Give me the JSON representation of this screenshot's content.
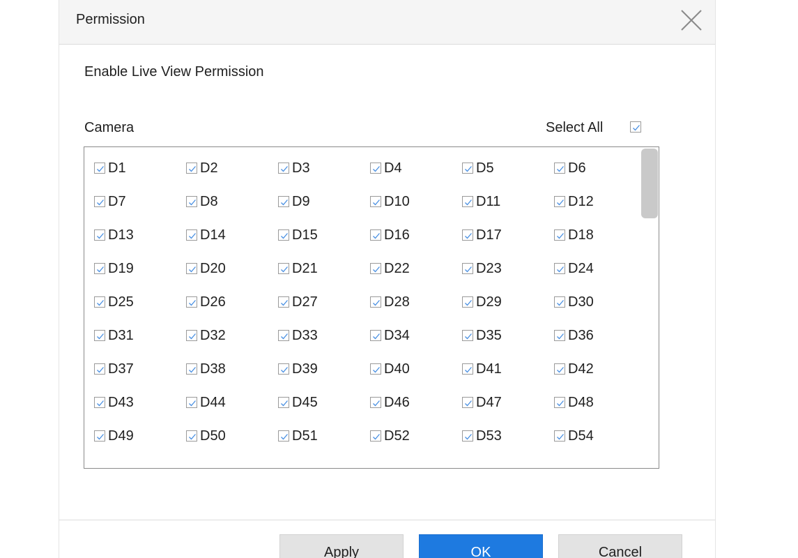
{
  "dialog": {
    "title": "Permission",
    "section_label": "Enable Live View Permission",
    "camera_label": "Camera",
    "select_all_label": "Select All",
    "select_all_checked": true
  },
  "cameras": [
    {
      "label": "D1",
      "checked": true
    },
    {
      "label": "D2",
      "checked": true
    },
    {
      "label": "D3",
      "checked": true
    },
    {
      "label": "D4",
      "checked": true
    },
    {
      "label": "D5",
      "checked": true
    },
    {
      "label": "D6",
      "checked": true
    },
    {
      "label": "D7",
      "checked": true
    },
    {
      "label": "D8",
      "checked": true
    },
    {
      "label": "D9",
      "checked": true
    },
    {
      "label": "D10",
      "checked": true
    },
    {
      "label": "D11",
      "checked": true
    },
    {
      "label": "D12",
      "checked": true
    },
    {
      "label": "D13",
      "checked": true
    },
    {
      "label": "D14",
      "checked": true
    },
    {
      "label": "D15",
      "checked": true
    },
    {
      "label": "D16",
      "checked": true
    },
    {
      "label": "D17",
      "checked": true
    },
    {
      "label": "D18",
      "checked": true
    },
    {
      "label": "D19",
      "checked": true
    },
    {
      "label": "D20",
      "checked": true
    },
    {
      "label": "D21",
      "checked": true
    },
    {
      "label": "D22",
      "checked": true
    },
    {
      "label": "D23",
      "checked": true
    },
    {
      "label": "D24",
      "checked": true
    },
    {
      "label": "D25",
      "checked": true
    },
    {
      "label": "D26",
      "checked": true
    },
    {
      "label": "D27",
      "checked": true
    },
    {
      "label": "D28",
      "checked": true
    },
    {
      "label": "D29",
      "checked": true
    },
    {
      "label": "D30",
      "checked": true
    },
    {
      "label": "D31",
      "checked": true
    },
    {
      "label": "D32",
      "checked": true
    },
    {
      "label": "D33",
      "checked": true
    },
    {
      "label": "D34",
      "checked": true
    },
    {
      "label": "D35",
      "checked": true
    },
    {
      "label": "D36",
      "checked": true
    },
    {
      "label": "D37",
      "checked": true
    },
    {
      "label": "D38",
      "checked": true
    },
    {
      "label": "D39",
      "checked": true
    },
    {
      "label": "D40",
      "checked": true
    },
    {
      "label": "D41",
      "checked": true
    },
    {
      "label": "D42",
      "checked": true
    },
    {
      "label": "D43",
      "checked": true
    },
    {
      "label": "D44",
      "checked": true
    },
    {
      "label": "D45",
      "checked": true
    },
    {
      "label": "D46",
      "checked": true
    },
    {
      "label": "D47",
      "checked": true
    },
    {
      "label": "D48",
      "checked": true
    },
    {
      "label": "D49",
      "checked": true
    },
    {
      "label": "D50",
      "checked": true
    },
    {
      "label": "D51",
      "checked": true
    },
    {
      "label": "D52",
      "checked": true
    },
    {
      "label": "D53",
      "checked": true
    },
    {
      "label": "D54",
      "checked": true
    }
  ],
  "buttons": {
    "apply": "Apply",
    "ok": "OK",
    "cancel": "Cancel"
  },
  "icons": {
    "close": "close-icon",
    "check": "check-icon"
  },
  "colors": {
    "primary": "#1e7ae0",
    "check": "#4a90e2",
    "secondary_button": "#e3e3e3",
    "header_bg": "#f5f5f5"
  }
}
